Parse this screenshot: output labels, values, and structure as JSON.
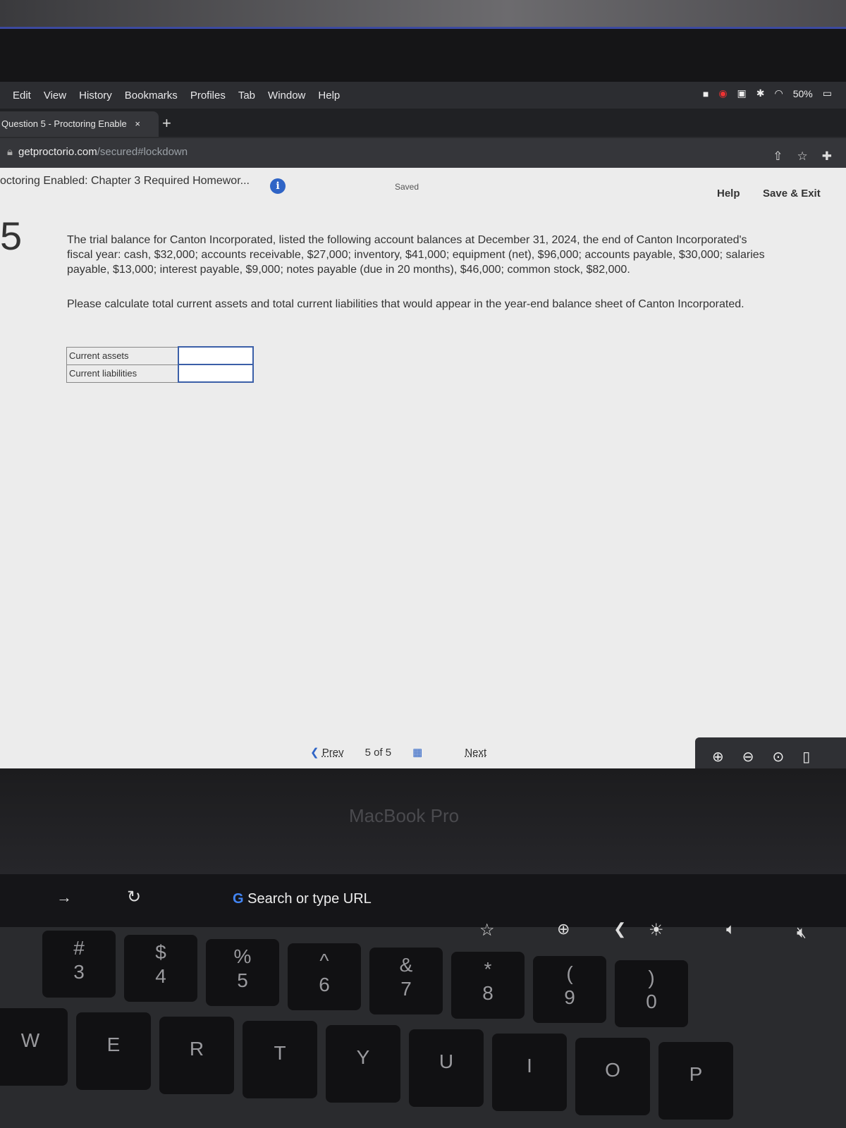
{
  "menubar": {
    "items": [
      "Edit",
      "View",
      "History",
      "Bookmarks",
      "Profiles",
      "Tab",
      "Window",
      "Help"
    ],
    "battery": "50%"
  },
  "tab": {
    "title": "Question 5 - Proctoring Enable",
    "close": "×",
    "new_tab": "+"
  },
  "url": {
    "domain": "getproctorio.com",
    "path": "/secured#lockdown"
  },
  "header": {
    "title": "octoring Enabled: Chapter 3 Required Homewor...",
    "info": "i",
    "saved": "Saved",
    "help": "Help",
    "save_exit": "Save & Exit"
  },
  "question": {
    "number": "5",
    "text": "The trial balance for Canton Incorporated, listed the following account balances at December 31, 2024, the end of Canton Incorporated's fiscal year: cash, $32,000; accounts receivable, $27,000; inventory, $41,000; equipment (net), $96,000; accounts payable, $30,000; salaries payable, $13,000; interest payable, $9,000; notes payable (due in 20 months), $46,000; common stock, $82,000.",
    "prompt": "Please calculate total current assets and total current liabilities that would appear in the year-end balance sheet of Canton Incorporated.",
    "rows": [
      {
        "label": "Current assets",
        "value": ""
      },
      {
        "label": "Current liabilities",
        "value": ""
      }
    ]
  },
  "nav": {
    "prev": "Prev",
    "position": "5 of 5",
    "next": "Next"
  },
  "laptop": {
    "brand": "MacBook Pro",
    "touchbar_search": "Search or type URL"
  },
  "keys": {
    "numbers": [
      [
        "#",
        "3"
      ],
      [
        "$",
        "4"
      ],
      [
        "%",
        "5"
      ],
      [
        "^",
        "6"
      ],
      [
        "&",
        "7"
      ],
      [
        "*",
        "8"
      ],
      [
        "(",
        "9"
      ],
      [
        ")",
        "0"
      ]
    ],
    "letters": [
      "W",
      "E",
      "R",
      "T",
      "Y",
      "U",
      "I",
      "O",
      "P"
    ]
  }
}
